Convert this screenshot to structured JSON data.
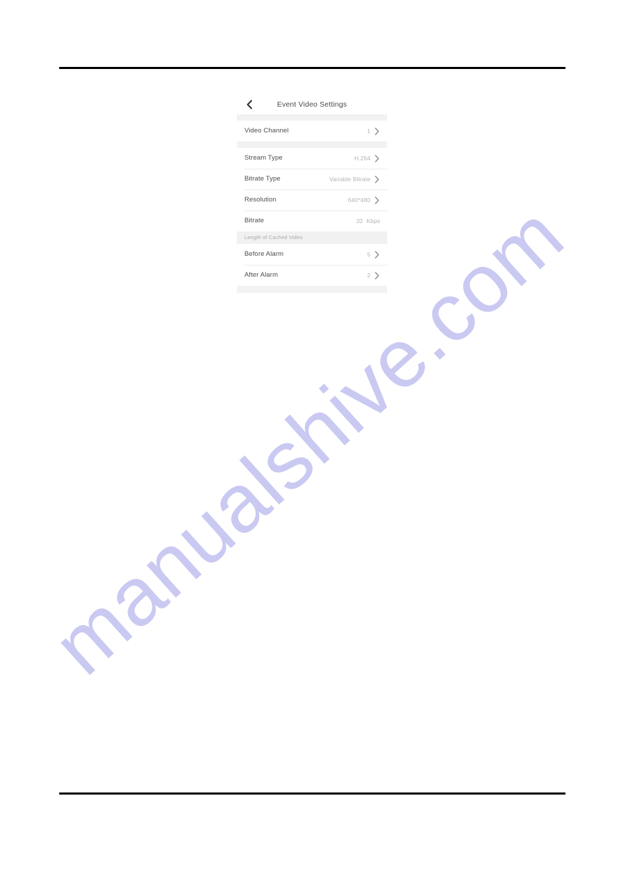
{
  "page": {
    "background_color": "#ffffff",
    "rule_color": "#000000"
  },
  "watermark": {
    "text": "manualshive.com",
    "color": "#c9c9f2",
    "rotation_deg": -42
  },
  "screenshot": {
    "titlebar": {
      "back_icon": "chevron-left-icon",
      "title": "Event Video Settings"
    },
    "groups": [
      {
        "rows": [
          {
            "label": "Video Channel",
            "value": "1",
            "unit": "",
            "chevron": true
          }
        ]
      },
      {
        "rows": [
          {
            "label": "Stream Type",
            "value": "H.264",
            "unit": "",
            "chevron": true
          },
          {
            "label": "Bitrate Type",
            "value": "Variable Bitrate",
            "unit": "",
            "chevron": true
          },
          {
            "label": "Resolution",
            "value": "640*480",
            "unit": "",
            "chevron": true
          },
          {
            "label": "Bitrate",
            "value": "32",
            "unit": "Kbps",
            "chevron": false
          }
        ]
      }
    ],
    "section_header": "Length of Cached Video",
    "cached_video_rows": [
      {
        "label": "Before Alarm",
        "value": "5",
        "unit": "",
        "chevron": true
      },
      {
        "label": "After Alarm",
        "value": "2",
        "unit": "",
        "chevron": true
      }
    ]
  }
}
